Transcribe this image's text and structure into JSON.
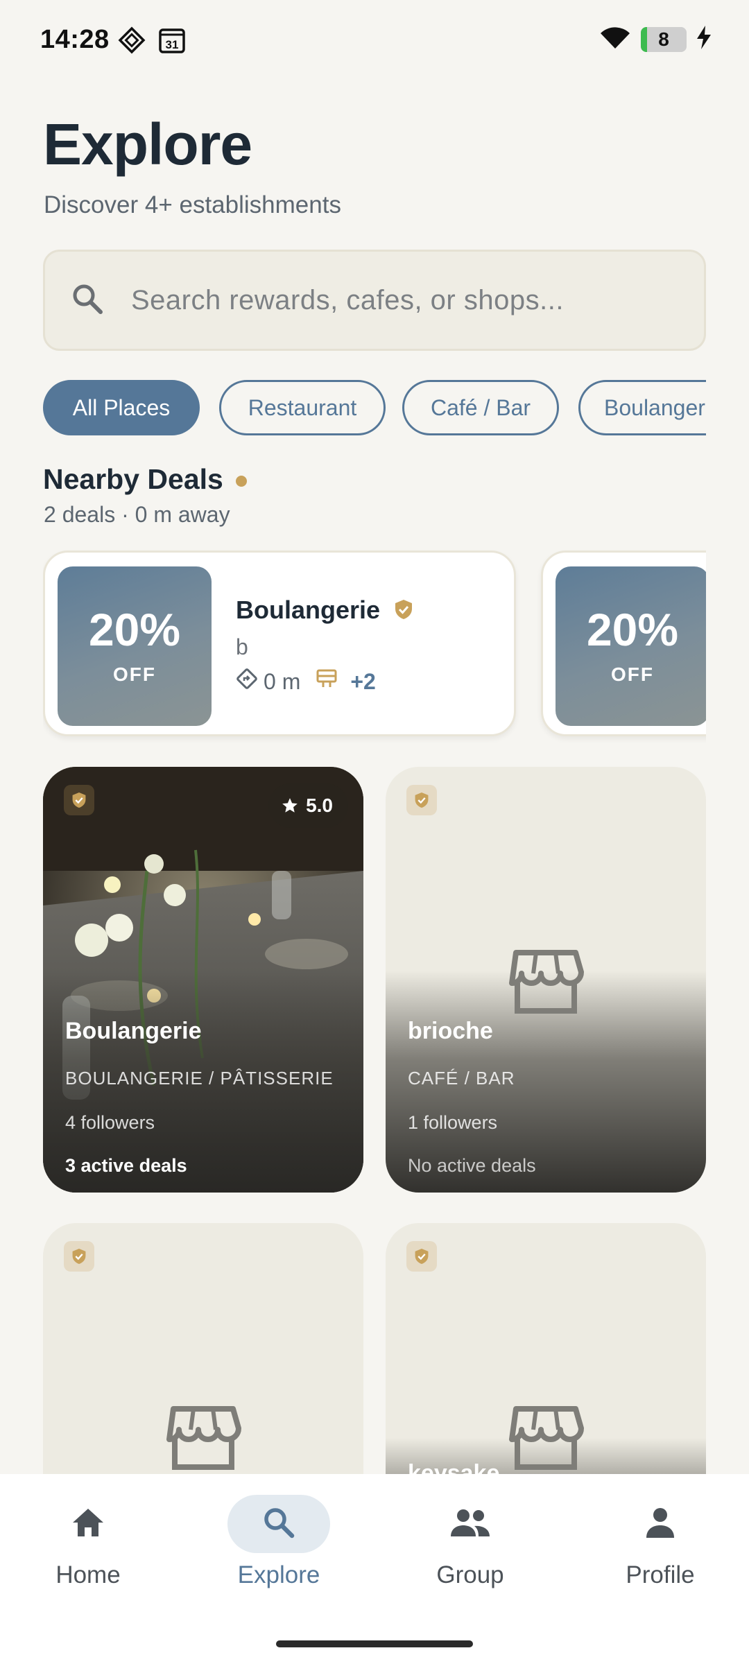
{
  "status_bar": {
    "time": "14:28",
    "calendar_day": "31",
    "battery_level": "8"
  },
  "header": {
    "title": "Explore",
    "subtitle": "Discover 4+ establishments"
  },
  "search": {
    "placeholder": "Search rewards, cafes, or shops..."
  },
  "filters": {
    "chips": [
      {
        "label": "All Places",
        "active": true
      },
      {
        "label": "Restaurant",
        "active": false
      },
      {
        "label": "Café / Bar",
        "active": false
      },
      {
        "label": "Boulangerie",
        "active": false
      }
    ]
  },
  "nearby": {
    "title": "Nearby Deals",
    "subtitle": "2 deals · 0 m away",
    "deals": [
      {
        "percent": "20%",
        "off": "OFF",
        "name": "Boulangerie",
        "description": "b",
        "distance": "0 m",
        "extra": "+2"
      },
      {
        "percent": "20%",
        "off": "OFF"
      }
    ]
  },
  "places": [
    {
      "name": "Boulangerie",
      "category": "BOULANGERIE / PÂTISSERIE",
      "followers": "4 followers",
      "deals": "3 active deals",
      "rating": "5.0",
      "has_photo": true
    },
    {
      "name": "brioche",
      "category": "CAFÉ / BAR",
      "followers": "1 followers",
      "deals": "No active deals",
      "has_photo": false
    },
    {
      "name": "",
      "has_photo": false
    },
    {
      "name": "keysake",
      "has_photo": false
    }
  ],
  "bottom_nav": {
    "items": [
      {
        "label": "Home",
        "icon": "home-icon"
      },
      {
        "label": "Explore",
        "icon": "search-icon",
        "active": true
      },
      {
        "label": "Group",
        "icon": "group-icon"
      },
      {
        "label": "Profile",
        "icon": "profile-icon"
      }
    ]
  },
  "colors": {
    "accent": "#557798",
    "gold": "#C8A15A",
    "background": "#F6F5F1"
  }
}
